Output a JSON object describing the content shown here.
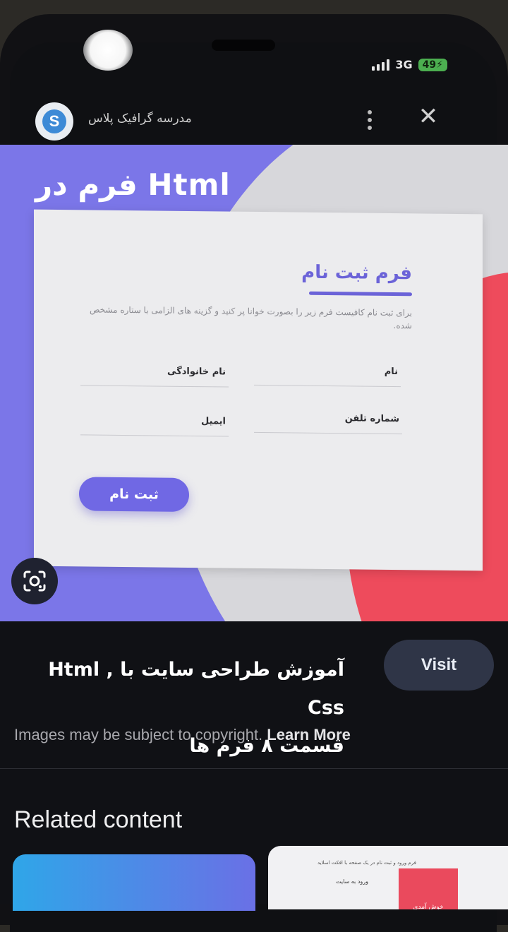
{
  "status_bar": {
    "network": "3G",
    "battery": "49"
  },
  "header": {
    "site_name": "مدرسه گرافیک پلاس",
    "close_glyph": "✕"
  },
  "image": {
    "title": "فرم در Html",
    "form": {
      "heading": "فرم ثبت نام",
      "description": "برای ثبت نام کافیست فرم زیر را بصورت خوانا پر کنید و گزینه های الزامی با ستاره مشخص شده.",
      "fields": {
        "first_name": "نام",
        "last_name": "نام خانوادگی",
        "phone": "شماره تلفن",
        "email": "ایمیل"
      },
      "submit": "ثبت نام"
    }
  },
  "result": {
    "title_line1": "آموزش طراحی سایت با Html , Css",
    "title_line2": "قسمت ۸ فرم ها",
    "visit": "Visit",
    "copyright": "Images may be subject to copyright.",
    "learn_more": "Learn More"
  },
  "related": {
    "title": "Related content",
    "thumb2_head": "فرم ورود و ثبت نام در یک صفحه با افکت اسلاید",
    "thumb2_left": "ورود به سایت",
    "thumb2_right": "خوش آمدی"
  },
  "colors": {
    "form_accent": "#6b63d8",
    "visit_bg": "#2f3547",
    "image_purple": "#7b76e8",
    "image_red": "#ee4b5c"
  },
  "icons": [
    "site-logo-icon",
    "more-vert-icon",
    "close-icon",
    "lens-search-icon"
  ]
}
